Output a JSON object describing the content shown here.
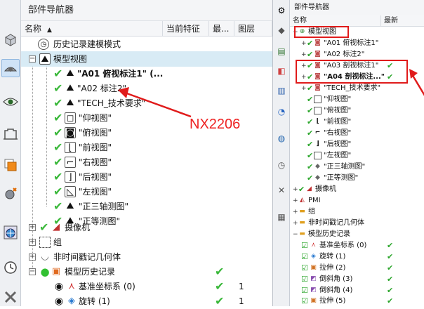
{
  "left": {
    "title": "部件导航器",
    "columns": [
      "名称",
      "当前特征",
      "最...",
      "图层"
    ],
    "sort_arrow": "▲",
    "rows": [
      {
        "label": "历史记录建模模式"
      },
      {
        "label": "模型视图"
      },
      {
        "label": "\"A01  俯视标注1\" (..."
      },
      {
        "label": "\"A02  标注2\""
      },
      {
        "label": "\"TECH_技术要求\""
      },
      {
        "label": "\"仰视图\""
      },
      {
        "label": "\"俯视图\""
      },
      {
        "label": "\"前视图\""
      },
      {
        "label": "\"右视图\""
      },
      {
        "label": "\"后视图\""
      },
      {
        "label": "\"左视图\""
      },
      {
        "label": "\"正三轴测图\""
      },
      {
        "label": "\"正等测图\""
      },
      {
        "label": "摄像机"
      },
      {
        "label": "组"
      },
      {
        "label": "非时间戳记几何体"
      },
      {
        "label": "模型历史记录"
      },
      {
        "label": "基准坐标系 (0)",
        "layer": "1"
      },
      {
        "label": "旋转 (1)",
        "layer": "1"
      }
    ],
    "annotation": "NX2206"
  },
  "right": {
    "title": "部件导航器",
    "columns": [
      "名称",
      "最新"
    ],
    "rows": [
      {
        "label": "模型视图"
      },
      {
        "label": "\"A01  俯视标注1\""
      },
      {
        "label": "\"A02  标注2\""
      },
      {
        "label": "\"A03  剖视标注1\""
      },
      {
        "label": "\"A04  剖视标注...\""
      },
      {
        "label": "\"TECH_技术要求\""
      },
      {
        "label": "\"仰视图\""
      },
      {
        "label": "\"俯视图\""
      },
      {
        "label": "\"前视图\""
      },
      {
        "label": "\"右视图\""
      },
      {
        "label": "\"后视图\""
      },
      {
        "label": "\"左视图\""
      },
      {
        "label": "\"正三轴测图\""
      },
      {
        "label": "\"正等测图\""
      },
      {
        "label": "摄像机"
      },
      {
        "label": "PMI"
      },
      {
        "label": "组"
      },
      {
        "label": "非时间戳记几何体"
      },
      {
        "label": "模型历史记录"
      },
      {
        "label": "基准坐标系 (0)"
      },
      {
        "label": "旋转 (1)"
      },
      {
        "label": "拉伸 (2)"
      },
      {
        "label": "倒斜角 (3)"
      },
      {
        "label": "倒斜角 (4)"
      },
      {
        "label": "拉伸 (5)"
      }
    ]
  },
  "colors": {
    "check": "#3ab83a",
    "highlight": "#d8ebf5",
    "annotation": "#e01b1b"
  }
}
